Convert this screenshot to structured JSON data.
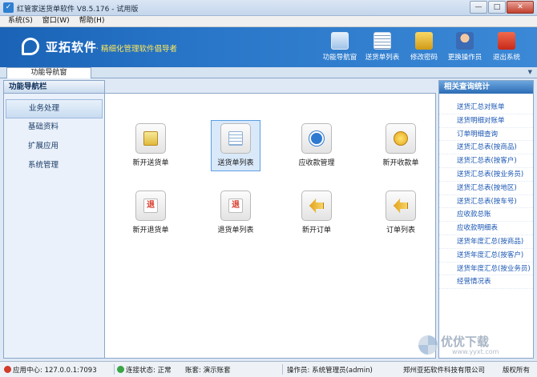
{
  "window": {
    "title": "红管家送货单软件 V8.5.176 - 试用版",
    "controls": [
      "—",
      "□",
      "✕"
    ]
  },
  "menubar": [
    "系统(S)",
    "窗口(W)",
    "帮助(H)"
  ],
  "header": {
    "brand": "亚拓软件",
    "slogan": "· 精细化管理软件倡导者",
    "toolbar": [
      {
        "label": "功能导航窗",
        "icon": "monitor-icon"
      },
      {
        "label": "送货单列表",
        "icon": "list-icon"
      },
      {
        "label": "修改密码",
        "icon": "lock-icon"
      },
      {
        "label": "更换操作员",
        "icon": "user-icon"
      },
      {
        "label": "退出系统",
        "icon": "power-icon"
      }
    ]
  },
  "tabs": [
    {
      "label": "功能导航窗"
    }
  ],
  "left_panel": {
    "title": "功能导航栏",
    "items": [
      "业务处理",
      "基础资料",
      "扩展应用",
      "系统管理"
    ],
    "active_index": 0
  },
  "modules": [
    {
      "label": "新开送货单",
      "icon": "cart-icon"
    },
    {
      "label": "送货单列表",
      "icon": "sheet-list-icon",
      "selected": true
    },
    {
      "label": "应收款管理",
      "icon": "download-icon"
    },
    {
      "label": "新开收款单",
      "icon": "gold-coin-icon"
    },
    {
      "label": "新开退货单",
      "icon": "return-icon"
    },
    {
      "label": "退货单列表",
      "icon": "return-list-icon"
    },
    {
      "label": "新开订单",
      "icon": "arrow-left-icon"
    },
    {
      "label": "订单列表",
      "icon": "order-list-icon"
    }
  ],
  "right_panel": {
    "title": "相关查询统计",
    "links": [
      "送货汇总对账单",
      "送货明细对账单",
      "订单明细查询",
      "送货汇总表(按商品)",
      "送货汇总表(按客户)",
      "送货汇总表(按业务员)",
      "送货汇总表(按地区)",
      "送货汇总表(按车号)",
      "应收款总账",
      "应收款明细表",
      "送货年度汇总(按商品)",
      "送货年度汇总(按客户)",
      "送货年度汇总(按业务员)",
      "经营情况表"
    ]
  },
  "watermark": {
    "text": "优优下载",
    "url": "www.yyxt.com"
  },
  "status": {
    "app_center": "应用中心: 127.0.0.1:7093",
    "connection": "连接状态: 正常",
    "account": "账套: 演示账套",
    "operator": "操作员: 系统管理员(admin)",
    "company": "郑州亚拓软件科技有限公司",
    "copyright": "版权所有"
  }
}
